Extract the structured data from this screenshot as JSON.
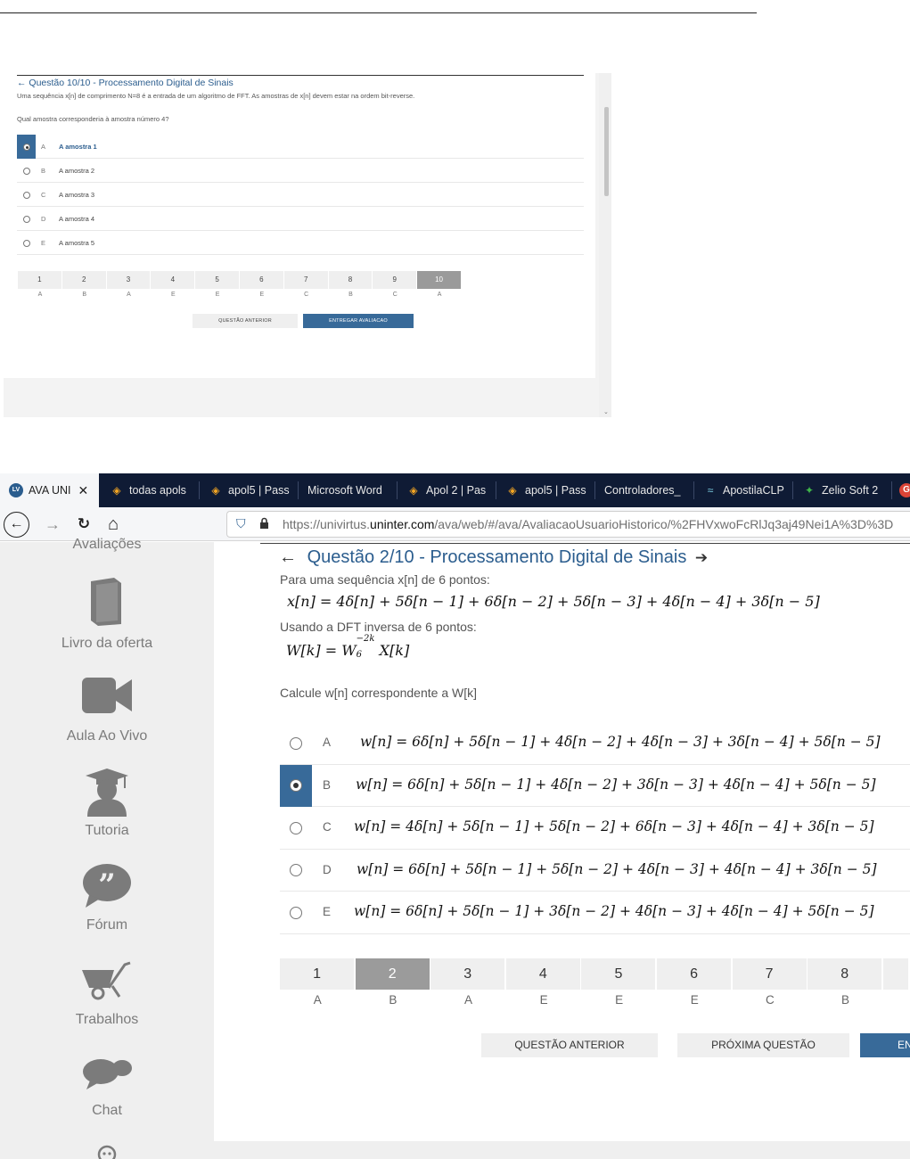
{
  "screen1": {
    "back_arrow": "←",
    "title": "Questão 10/10 - Processamento Digital de Sinais",
    "statement": "Uma sequência x[n] de comprimento N=8 é a entrada de um algoritmo de FFT. As amostras de x[n] devem estar na ordem bit-reverse.",
    "question": "Qual amostra corresponderia à amostra número 4?",
    "options": [
      {
        "letter": "A",
        "text": "A amostra 1",
        "selected": true
      },
      {
        "letter": "B",
        "text": "A amostra 2",
        "selected": false
      },
      {
        "letter": "C",
        "text": "A amostra 3",
        "selected": false
      },
      {
        "letter": "D",
        "text": "A amostra 4",
        "selected": false
      },
      {
        "letter": "E",
        "text": "A amostra 5",
        "selected": false
      }
    ],
    "nav": [
      {
        "num": "1",
        "ans": "A"
      },
      {
        "num": "2",
        "ans": "B"
      },
      {
        "num": "3",
        "ans": "A"
      },
      {
        "num": "4",
        "ans": "E"
      },
      {
        "num": "5",
        "ans": "E"
      },
      {
        "num": "6",
        "ans": "E"
      },
      {
        "num": "7",
        "ans": "C"
      },
      {
        "num": "8",
        "ans": "B"
      },
      {
        "num": "9",
        "ans": "C"
      },
      {
        "num": "10",
        "ans": "A"
      }
    ],
    "current_question": "10",
    "buttons": {
      "previous": "QUESTÃO ANTERIOR",
      "submit": "ENTREGAR AVALIACAO"
    },
    "scroll_arrow": "⌄"
  },
  "screen2": {
    "tabs": [
      {
        "label": "AVA UNI",
        "icon": "ava-logo-icon",
        "glyph": "LV",
        "active": true,
        "close": "✕"
      },
      {
        "label": "todas apols",
        "icon": "graduation-cap-icon",
        "glyph": "🎓"
      },
      {
        "label": "apol5 | Pass",
        "icon": "graduation-cap-icon",
        "glyph": "🎓"
      },
      {
        "label": "Microsoft Word",
        "icon": "",
        "glyph": ""
      },
      {
        "label": "Apol 2 | Pas",
        "icon": "graduation-cap-icon",
        "glyph": "🎓"
      },
      {
        "label": "apol5 | Pass",
        "icon": "graduation-cap-icon",
        "glyph": "🎓"
      },
      {
        "label": "Controladores_",
        "icon": "",
        "glyph": ""
      },
      {
        "label": "ApostilaCLP",
        "icon": "wing-logo-icon",
        "glyph": "≈"
      },
      {
        "label": "Zelio Soft 2",
        "icon": "zelio-logo-icon",
        "glyph": "✦"
      },
      {
        "label": "",
        "icon": "google-icon",
        "glyph": "G"
      }
    ],
    "url": {
      "prefix": "https://univirtus.",
      "domain": "uninter.com",
      "path": "/ava/web/#/ava/AvaliacaoUsuarioHistorico/%2FHVxwoFcRlJq3aj49Nei1A%3D%3D"
    },
    "browser_icons": {
      "back": "←",
      "forward": "→",
      "reload": "C",
      "home": "⌂",
      "shield": "⛉",
      "lock": "🔒"
    },
    "sidebar": [
      {
        "label": "Avaliações",
        "icon": ""
      },
      {
        "label": "Livro da oferta",
        "icon": "book-icon"
      },
      {
        "label": "Aula Ao Vivo",
        "icon": "video-camera-icon"
      },
      {
        "label": "Tutoria",
        "icon": "tutor-icon"
      },
      {
        "label": "Fórum",
        "icon": "quote-bubble-icon"
      },
      {
        "label": "Trabalhos",
        "icon": "wheelbarrow-icon"
      },
      {
        "label": "Chat",
        "icon": "chat-bubbles-icon"
      }
    ],
    "back_arrow": "←",
    "forward_arrow": "➔",
    "title": "Questão 2/10 - Processamento Digital de Sinais",
    "intro": "Para uma sequência x[n] de 6 pontos:",
    "eq_x": "x[n] = 4δ[n] + 5δ[n − 1] + 6δ[n − 2] + 5δ[n − 3] + 4δ[n − 4] + 3δ[n − 5]",
    "intro2": "Usando a DFT inversa de 6 pontos:",
    "eq_w_lhs": "W[k] = W",
    "eq_w_sub": "6",
    "eq_w_sup": "−2k",
    "eq_w_rhs": "X[k]",
    "question": "Calcule w[n] correspondente a W[k]",
    "options": [
      {
        "letter": "A",
        "text": "w[n] = 6δ[n] + 5δ[n − 1] + 4δ[n − 2] + 4δ[n − 3] + 3δ[n − 4] + 5δ[n − 5]",
        "selected": false
      },
      {
        "letter": "B",
        "text": "w[n] = 6δ[n] + 5δ[n − 1] + 4δ[n − 2] + 3δ[n − 3] + 4δ[n − 4] + 5δ[n − 5]",
        "selected": true
      },
      {
        "letter": "C",
        "text": "w[n] = 4δ[n] + 5δ[n − 1] + 5δ[n − 2] + 6δ[n − 3] + 4δ[n − 4] + 3δ[n − 5]",
        "selected": false
      },
      {
        "letter": "D",
        "text": "w[n] = 6δ[n] + 5δ[n − 1] + 5δ[n − 2] + 4δ[n − 3] + 4δ[n − 4] + 3δ[n − 5]",
        "selected": false
      },
      {
        "letter": "E",
        "text": "w[n] = 6δ[n] + 5δ[n − 1] + 3δ[n − 2] + 4δ[n − 3] + 4δ[n − 4] + 5δ[n − 5]",
        "selected": false
      }
    ],
    "nav": [
      {
        "num": "1",
        "ans": "A"
      },
      {
        "num": "2",
        "ans": "B"
      },
      {
        "num": "3",
        "ans": "A"
      },
      {
        "num": "4",
        "ans": "E"
      },
      {
        "num": "5",
        "ans": "E"
      },
      {
        "num": "6",
        "ans": "E"
      },
      {
        "num": "7",
        "ans": "C"
      },
      {
        "num": "8",
        "ans": "B"
      },
      {
        "num": "",
        "ans": ""
      }
    ],
    "current_question": "2",
    "buttons": {
      "previous": "QUESTÃO ANTERIOR",
      "next": "PRÓXIMA QUESTÃO",
      "submit": "EN"
    }
  },
  "colors": {
    "accent": "#2b5d8e",
    "selected_cell": "#386a99",
    "tabbar": "#0f1b35",
    "sidebar": "#efefef"
  }
}
